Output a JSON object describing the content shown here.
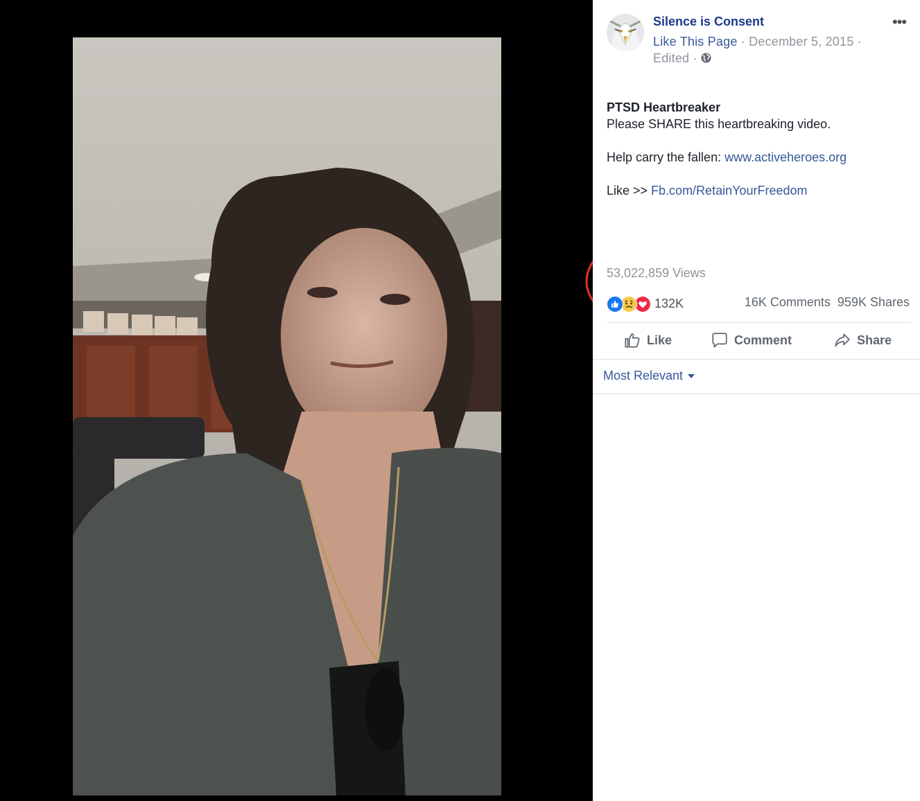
{
  "video": {
    "description": ""
  },
  "post": {
    "page_name": "Silence is Consent",
    "like_page_label": "Like This Page",
    "separator": " · ",
    "date": "December 5, 2015",
    "edited_label": "Edited",
    "privacy_icon": "globe-icon",
    "more_icon": "more-options-icon",
    "title": "PTSD Heartbreaker",
    "body_line": "Please SHARE this heartbreaking video.",
    "help_prefix": "Help carry the fallen: ",
    "help_link": "www.activeheroes.org",
    "like_prefix": "Like >> ",
    "like_link": "Fb.com/RetainYourFreedom"
  },
  "stats": {
    "views": "53,022,859 Views",
    "reaction_count": "132K",
    "reaction_icons": [
      "like-reaction-icon",
      "sad-reaction-icon",
      "love-reaction-icon"
    ],
    "comments": "16K Comments",
    "shares": "959K Shares"
  },
  "actions": {
    "like_label": "Like",
    "comment_label": "Comment",
    "share_label": "Share"
  },
  "comments": {
    "sort_label": "Most Relevant"
  },
  "colors": {
    "link": "#365899",
    "page_name": "#1d3a8a",
    "annotation_circle": "#e8321d",
    "like_blue": "#1877f2",
    "love_red": "#f0284a",
    "sad_yellow": "#f7c948"
  }
}
